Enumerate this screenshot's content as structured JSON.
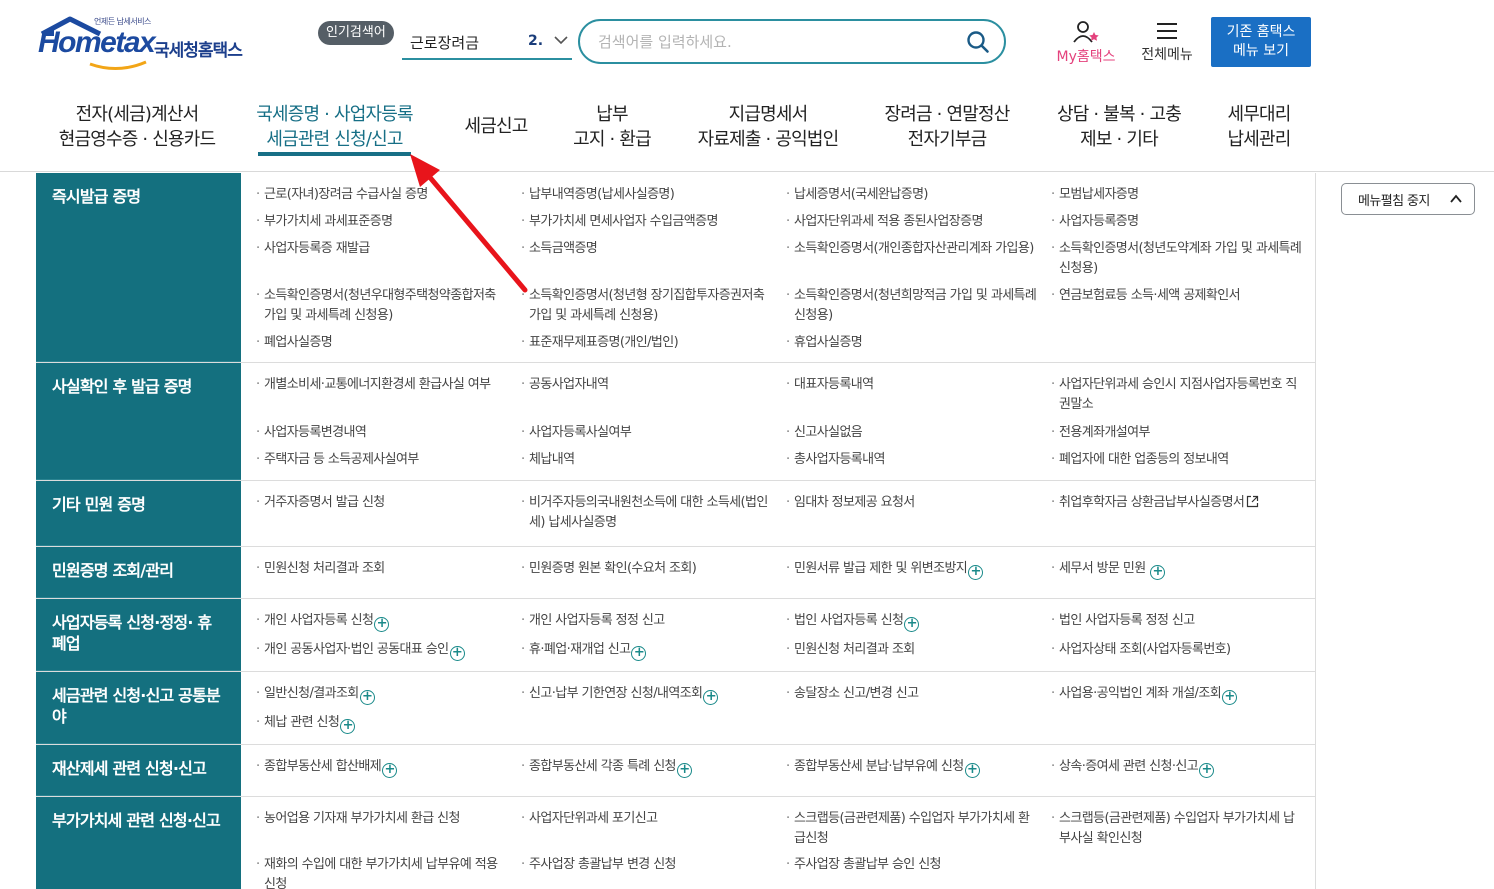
{
  "header": {
    "logo_sub": "언제든 납세서비스",
    "logo_word": "Hometax",
    "logo_kr": "국세청홈택스",
    "popular_badge": "인기검색어",
    "popular_term": "근로장려금",
    "popular_rank": "2.",
    "search_placeholder": "검색어를 입력하세요.",
    "my_hometax_prefix": "My",
    "my_hometax_suffix": "홈택스",
    "all_menu": "전체메뉴",
    "old_home_line1": "기존 홈택스",
    "old_home_line2": "메뉴 보기"
  },
  "gnb": [
    {
      "line1": "전자(세금)계산서",
      "line2": "현금영수증 · 신용카드"
    },
    {
      "line1": "국세증명 · 사업자등록",
      "line2": "세금관련 신청/신고",
      "active": true
    },
    {
      "line1": "세금신고",
      "line2": ""
    },
    {
      "line1": "납부",
      "line2": "고지 · 환급"
    },
    {
      "line1": "지급명세서",
      "line2": "자료제출 · 공익법인"
    },
    {
      "line1": "장려금 · 연말정산",
      "line2": "전자기부금"
    },
    {
      "line1": "상담 · 불복 · 고충",
      "line2": "제보 · 기타"
    },
    {
      "line1": "세무대리",
      "line2": "납세관리"
    }
  ],
  "stop_button": "메뉴펼침 중지",
  "sections": [
    {
      "title": "즉시발급 증명",
      "items": [
        "근로(자녀)장려금 수급사실 증명",
        "납부내역증명(납세사실증명)",
        "납세증명서(국세완납증명)",
        "모범납세자증명",
        "부가가치세 과세표준증명",
        "부가가치세 면세사업자 수입금액증명",
        "사업자단위과세 적용 종된사업장증명",
        "사업자등록증명",
        "사업자등록증 재발급",
        "소득금액증명",
        "소득확인증명서(개인종합자산관리계좌 가입용)",
        "소득확인증명서(청년도약계좌 가입 및 과세특례 신청용)",
        "소득확인증명서(청년우대형주택청약종합저축 가입 및 과세특례 신청용)",
        "소득확인증명서(청년형 장기집합투자증권저축 가입 및 과세특례 신청용)",
        "소득확인증명서(청년희망적금 가입 및 과세특례 신청용)",
        "연금보험료등 소득·세액 공제확인서",
        "폐업사실증명",
        "표준재무제표증명(개인/법인)",
        "휴업사실증명",
        ""
      ]
    },
    {
      "title": "사실확인 후 발급 증명",
      "items": [
        "개별소비세·교통에너지환경세 환급사실 여부",
        "공동사업자내역",
        "대표자등록내역",
        "사업자단위과세 승인시 지점사업자등록번호 직권말소",
        "사업자등록변경내역",
        "사업자등록사실여부",
        "신고사실없음",
        "전용계좌개설여부",
        "주택자금 등 소득공제사실여부",
        "체납내역",
        "총사업자등록내역",
        "폐업자에 대한 업종등의 정보내역"
      ]
    },
    {
      "title": "기타 민원 증명",
      "items": [
        "거주자증명서 발급 신청",
        "비거주자등의국내원천소득에 대한 소득세(법인세) 납세사실증명",
        "임대차 정보제공 요청서",
        "취업후학자금 상환금납부사실증명서"
      ]
    },
    {
      "title": "민원증명 조회/관리",
      "items": [
        "민원신청 처리결과 조회",
        "민원증명 원본 확인(수요처 조회)",
        "민원서류 발급 제한 및 위변조방지",
        "세무서 방문 민원"
      ]
    },
    {
      "title": "사업자등록 신청·정정· 휴폐업",
      "items": [
        "개인 사업자등록 신청",
        "개인 사업자등록 정정 신고",
        "법인 사업자등록 신청",
        "법인 사업자등록 정정 신고",
        "개인 공동사업자·법인 공동대표 승인",
        "휴·폐업·재개업 신고",
        "민원신청 처리결과 조회",
        "사업자상태 조회(사업자등록번호)"
      ]
    },
    {
      "title": "세금관련 신청·신고 공통분야",
      "items": [
        "일반신청/결과조회",
        "신고·납부 기한연장 신청/내역조회",
        "송달장소 신고/변경 신고",
        "사업용·공익법인 계좌 개설/조회",
        "체납 관련 신청"
      ]
    },
    {
      "title": "재산제세 관련 신청·신고",
      "items": [
        "종합부동산세 합산배제",
        "종합부동산세 각종 특례 신청",
        "종합부동산세 분납·납부유예 신청",
        "상속·증여세 관련 신청·신고"
      ]
    },
    {
      "title": "부가가치세 관련 신청·신고",
      "items": [
        "농어업용 기자재 부가가치세 환급 신청",
        "사업자단위과세 포기신고",
        "스크랩등(금관련제품) 수입업자 부가가치세 환급신청",
        "스크랩등(금관련제품) 수입업자 부가가치세 납부사실 확인신청",
        "재화의 수입에 대한 부가가치세 납부유예 적용 신청",
        "주사업장 총괄납부 변경 신청",
        "주사업장 총괄납부 승인 신청",
        ""
      ]
    }
  ],
  "colors": {
    "category_bg": "#14707f",
    "accent_teal": "#176f86",
    "old_home_btn": "#1a6fc4",
    "annotation_arrow": "#e8141b"
  }
}
